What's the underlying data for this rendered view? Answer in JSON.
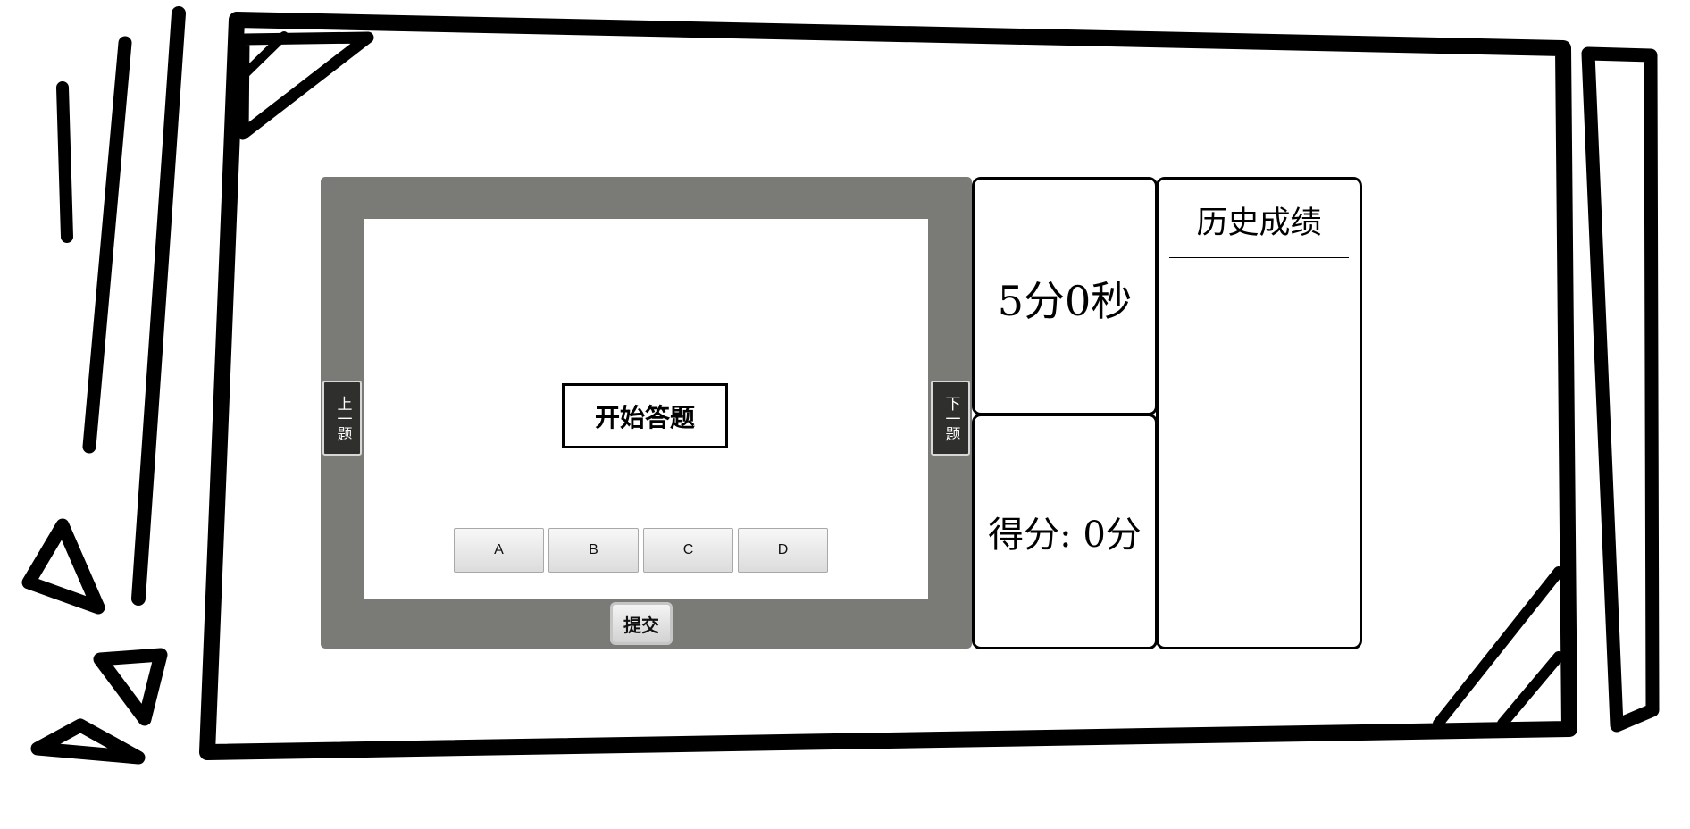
{
  "quiz": {
    "start_label": "开始答题",
    "options": [
      "A",
      "B",
      "C",
      "D"
    ],
    "prev_label": "上一题",
    "next_label": "下一题",
    "submit_label": "提交"
  },
  "timer": {
    "text": "5分0秒"
  },
  "score": {
    "text": "得分: 0分"
  },
  "history": {
    "title": "历史成绩",
    "entries": []
  },
  "colors": {
    "frame_gray": "#7a7a76",
    "nav_dark": "#2f2f2d",
    "stroke": "#000000"
  }
}
